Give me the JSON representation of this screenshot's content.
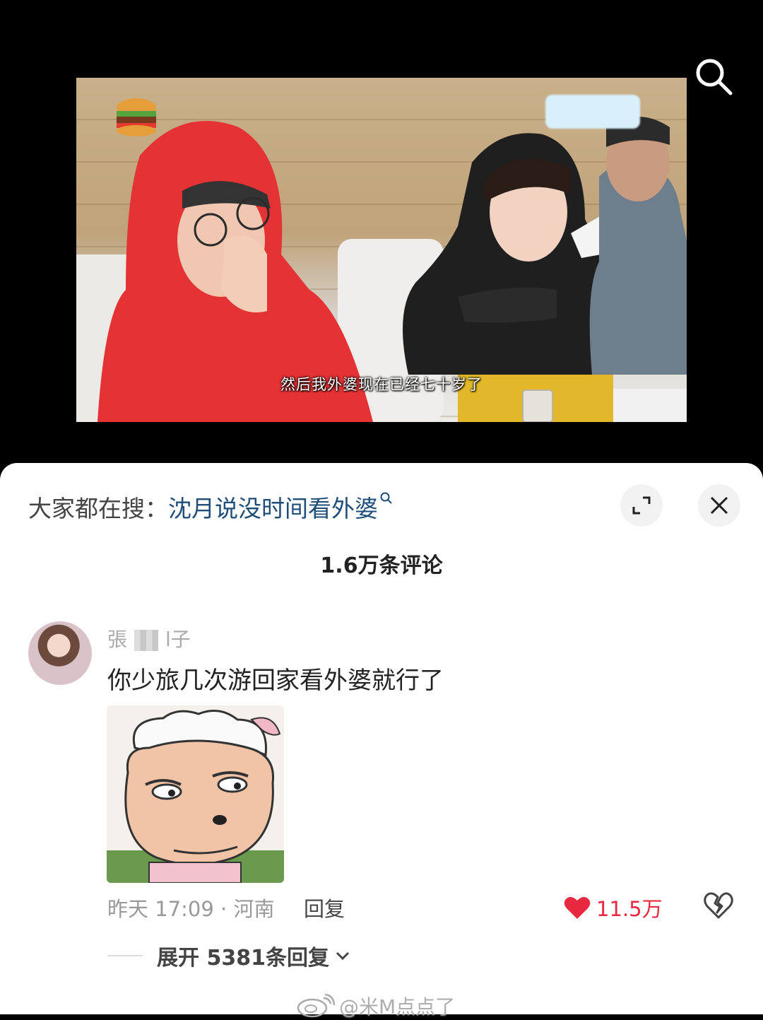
{
  "video": {
    "subtitle": "然后我外婆现在已经七十岁了"
  },
  "hot_search": {
    "label": "大家都在搜：",
    "term": "沈月说没时间看外婆"
  },
  "comments_header": {
    "count_label": "1.6万条评论"
  },
  "comment": {
    "username_start": "張",
    "username_end": "l子",
    "text": "你少旅几次游回家看外婆就行了",
    "time_location": "昨天 17:09 · 河南",
    "reply_label": "回复",
    "like_count": "11.5万",
    "expand_label": "展开 5381条回复"
  },
  "watermark": {
    "text": "@米M点点了"
  },
  "colors": {
    "like": "#e8283e",
    "link": "#1f4e7a"
  }
}
